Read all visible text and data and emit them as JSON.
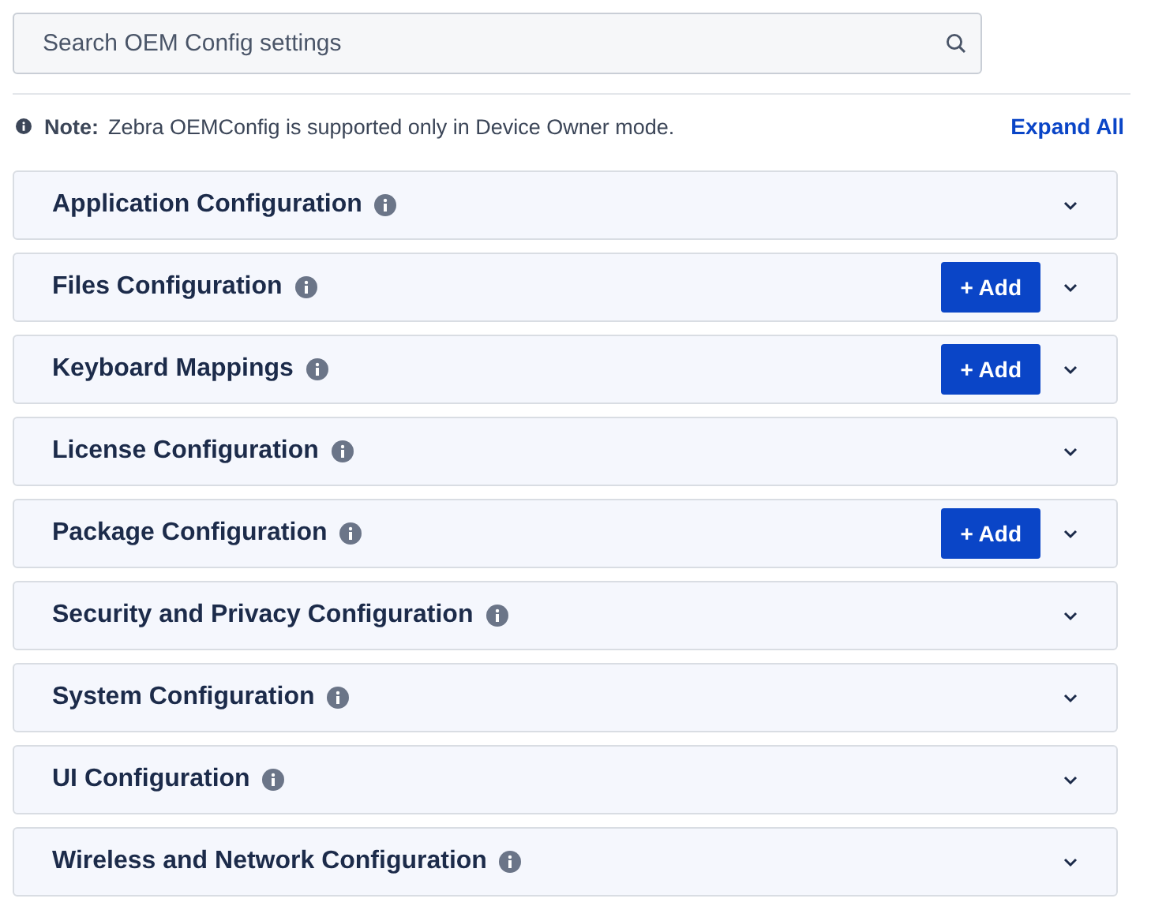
{
  "search": {
    "placeholder": "Search OEM Config settings"
  },
  "note": {
    "label": "Note:",
    "text": "Zebra OEMConfig is supported only in Device Owner mode."
  },
  "expand_all": "Expand All",
  "sections": [
    {
      "title": "Application Configuration",
      "expanded": false
    },
    {
      "title": "Files Configuration",
      "expanded": false,
      "add_button": "+ Add"
    },
    {
      "title": "Keyboard Mappings",
      "expanded": false,
      "add_button": "+ Add"
    },
    {
      "title": "License Configuration",
      "expanded": false
    },
    {
      "title": "Package Configuration",
      "expanded": false,
      "add_button": "+ Add"
    },
    {
      "title": "Security and Privacy Configuration",
      "expanded": false
    },
    {
      "title": "System Configuration",
      "expanded": false
    },
    {
      "title": "UI Configuration",
      "expanded": false
    },
    {
      "title": "Wireless and Network Configuration",
      "expanded": false
    }
  ]
}
